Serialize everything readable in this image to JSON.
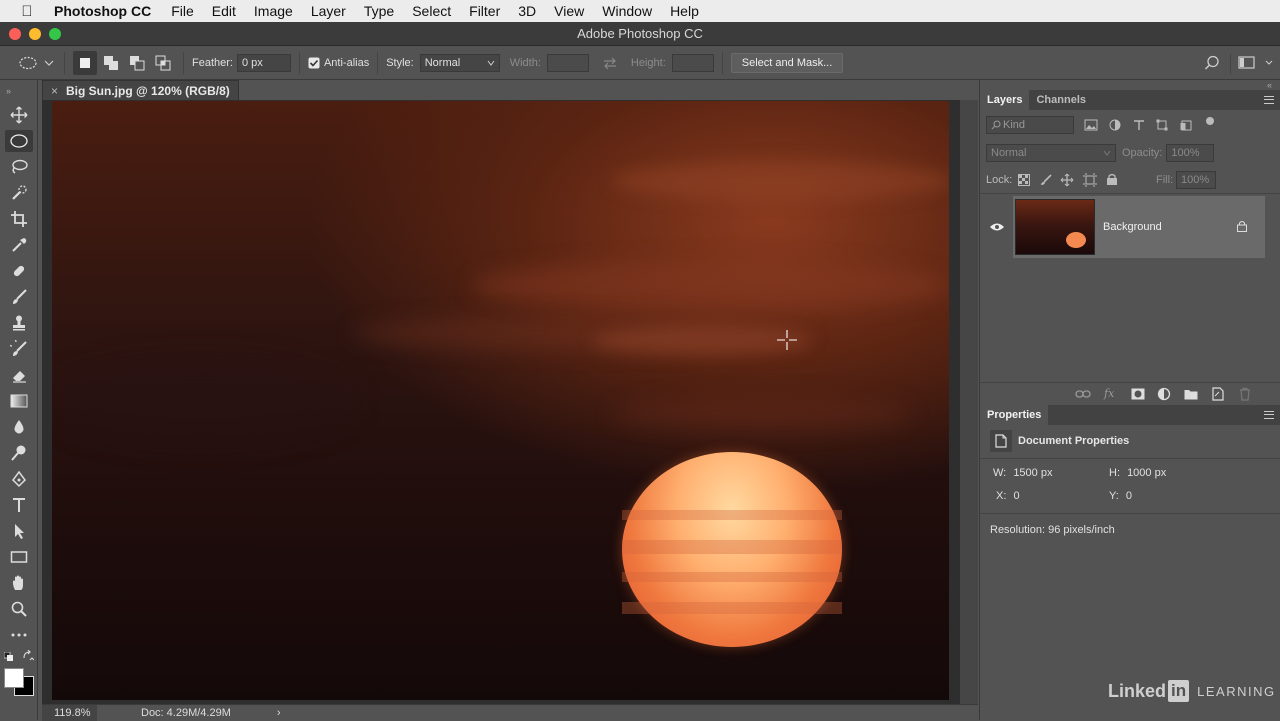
{
  "menubar": {
    "app_name": "Photoshop CC",
    "items": [
      "File",
      "Edit",
      "Image",
      "Layer",
      "Type",
      "Select",
      "Filter",
      "3D",
      "View",
      "Window",
      "Help"
    ]
  },
  "window": {
    "title": "Adobe Photoshop CC"
  },
  "options": {
    "feather_label": "Feather:",
    "feather_value": "0 px",
    "antialias_label": "Anti-alias",
    "antialias_checked": true,
    "style_label": "Style:",
    "style_value": "Normal",
    "width_label": "Width:",
    "height_label": "Height:",
    "select_mask_label": "Select and Mask..."
  },
  "document": {
    "tab_title": "Big Sun.jpg @ 120% (RGB/8)",
    "close_glyph": "×"
  },
  "status": {
    "zoom": "119.8%",
    "doc_size": "Doc: 4.29M/4.29M",
    "arrow": "›"
  },
  "layers_panel": {
    "tabs": [
      "Layers",
      "Channels"
    ],
    "filter_label": "Kind",
    "blend_mode": "Normal",
    "opacity_label": "Opacity:",
    "opacity_value": "100%",
    "lock_label": "Lock:",
    "fill_label": "Fill:",
    "fill_value": "100%",
    "layers": [
      {
        "name": "Background",
        "visible": true,
        "locked": true
      }
    ]
  },
  "properties_panel": {
    "tab": "Properties",
    "heading": "Document Properties",
    "w_label": "W:",
    "w_value": "1500 px",
    "h_label": "H:",
    "h_value": "1000 px",
    "x_label": "X:",
    "x_value": "0",
    "y_label": "Y:",
    "y_value": "0",
    "resolution": "Resolution: 96 pixels/inch"
  },
  "watermark": {
    "left": "Linked",
    "in": "in",
    "right": "LEARNING"
  },
  "colors": {
    "traffic_red": "#fc5f57",
    "traffic_yellow": "#fdbc2e",
    "traffic_green": "#33c748",
    "panel_bg": "#535353",
    "selected_layer": "#6a6a6a"
  }
}
